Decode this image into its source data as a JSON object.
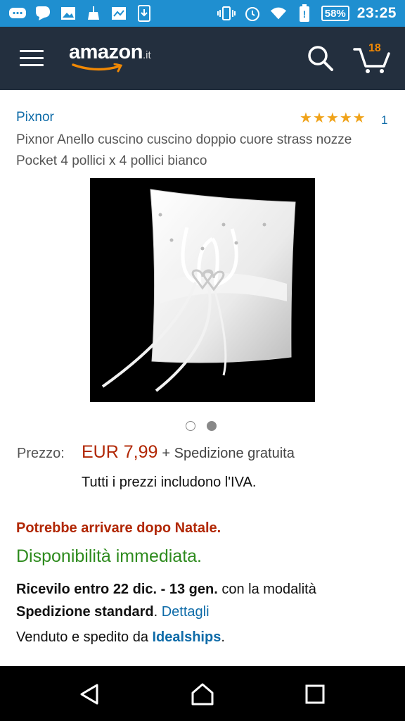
{
  "status_bar": {
    "battery": "58%",
    "time": "23:25"
  },
  "header": {
    "logo_main": "amazon",
    "logo_tld": ".it",
    "cart_count": "18"
  },
  "product": {
    "brand": "Pixnor",
    "rating_stars": 5,
    "rating_count": "1",
    "title": "Pixnor Anello cuscino cuscino doppio cuore strass nozze Pocket 4 pollici x 4 pollici bianco",
    "image_count": 2,
    "active_image": 2
  },
  "price": {
    "label": "Prezzo:",
    "value": "EUR 7,99",
    "shipping": "+ Spedizione gratuita",
    "vat_note": "Tutti i prezzi includono l'IVA."
  },
  "availability": {
    "warning": "Potrebbe arrivare dopo Natale.",
    "status": "Disponibilità immediata."
  },
  "delivery": {
    "receive_bold": "Ricevilo entro 22 dic. - 13 gen.",
    "receive_rest": " con la modalità",
    "method_bold": "Spedizione standard",
    "method_dot": ". ",
    "details_link": "Dettagli"
  },
  "seller": {
    "prefix": "Venduto e spedito da ",
    "name": "Idealships",
    "suffix": "."
  },
  "colors": {
    "status_bar": "#1f8fd0",
    "header": "#232f3e",
    "price": "#b12704",
    "availability": "#2e8b1e",
    "link": "#0e6ba8",
    "star": "#f0a31a"
  }
}
